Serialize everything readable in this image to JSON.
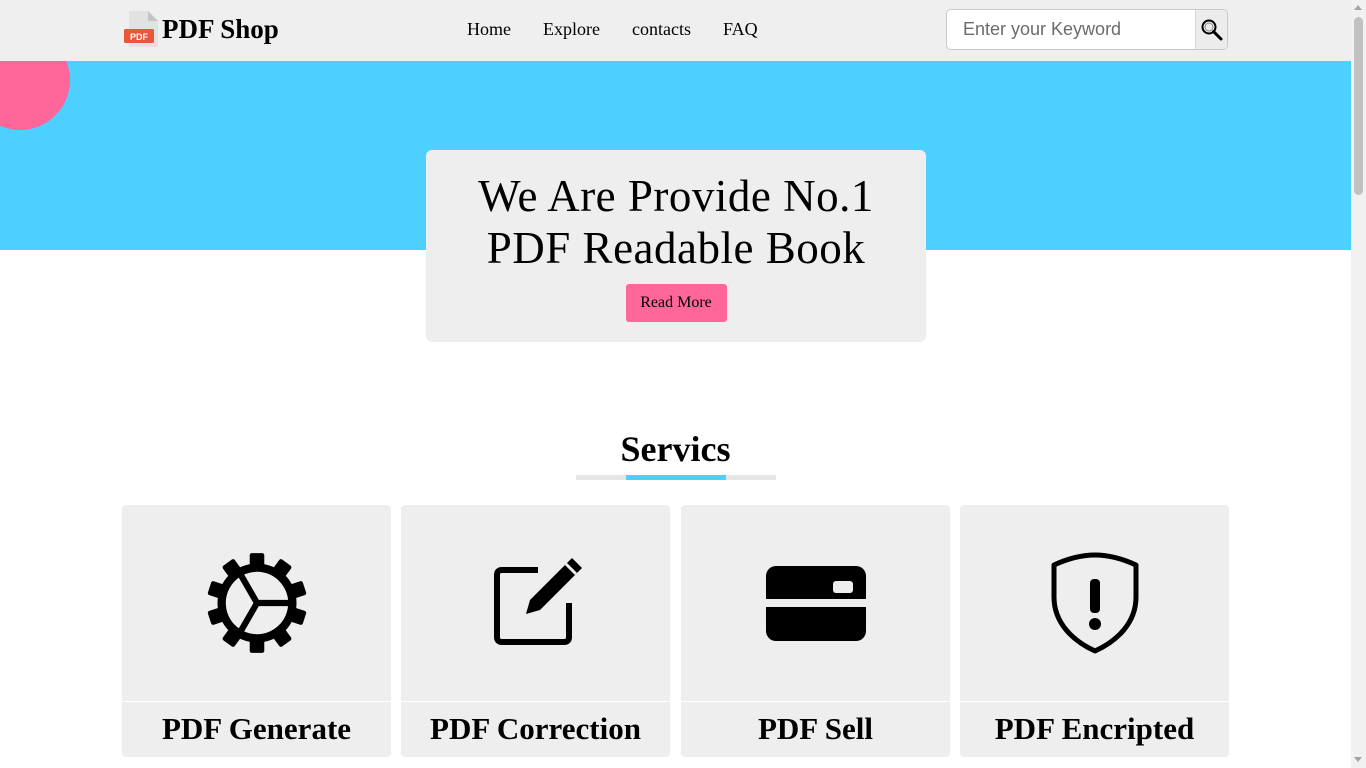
{
  "header": {
    "logo_badge": "PDF",
    "brand": "PDF Shop",
    "nav": [
      {
        "label": "Home"
      },
      {
        "label": "Explore"
      },
      {
        "label": "contacts"
      },
      {
        "label": "FAQ"
      }
    ],
    "search": {
      "placeholder": "Enter your Keyword",
      "value": "",
      "icon": "magnifier-icon"
    }
  },
  "hero": {
    "title_line1": "We Are Provide No.1",
    "title_line2": "PDF Readable Book",
    "button_label": "Read More",
    "accent_color": "#4dd0ff",
    "circle_color": "#ff6699"
  },
  "services": {
    "title": "Servics",
    "cards": [
      {
        "title": "PDF Generate",
        "icon": "gear-icon"
      },
      {
        "title": "PDF Correction",
        "icon": "edit-icon"
      },
      {
        "title": "PDF Sell",
        "icon": "credit-card-icon"
      },
      {
        "title": "PDF Encripted",
        "icon": "shield-alert-icon"
      }
    ]
  },
  "colors": {
    "primary": "#4dd0ff",
    "accent": "#ff6699",
    "card_bg": "#eeeeee"
  }
}
